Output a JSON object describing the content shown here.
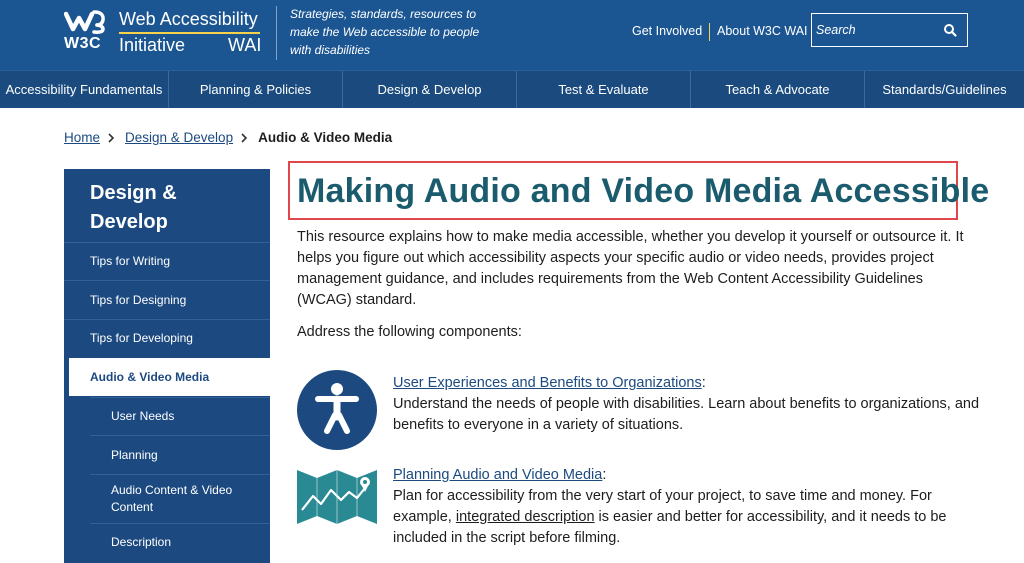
{
  "header": {
    "logo_w3c": "W3C",
    "logo_title_line1": "Web Accessibility",
    "logo_title_line2a": "Initiative",
    "logo_title_line2b": "WAI",
    "tagline": "Strategies, standards, resources to make the Web accessible to people with disabilities",
    "links": [
      "Get Involved",
      "About W3C WAI"
    ],
    "search_placeholder": "Search",
    "search_icon": "search-icon"
  },
  "nav": {
    "items": [
      "Accessibility Fundamentals",
      "Planning & Policies",
      "Design & Develop",
      "Test & Evaluate",
      "Teach & Advocate",
      "Standards/Guidelines"
    ]
  },
  "breadcrumb": {
    "items": [
      "Home",
      "Design & Develop"
    ],
    "current": "Audio & Video Media"
  },
  "sidebar": {
    "title": "Design & Develop",
    "items": [
      {
        "label": "Tips for Writing"
      },
      {
        "label": "Tips for Designing"
      },
      {
        "label": "Tips for Developing"
      },
      {
        "label": "Audio & Video Media"
      },
      {
        "label": "User Needs"
      },
      {
        "label": "Planning"
      },
      {
        "label": "Audio Content & Video Content"
      },
      {
        "label": "Description"
      }
    ]
  },
  "main": {
    "title": "Making Audio and Video Media Accessible",
    "intro": "This resource explains how to make media accessible, whether you develop it yourself or outsource it. It helps you figure out which accessibility aspects your specific audio or video needs, provides project management guidance, and includes requirements from the Web Content Accessibility Guidelines (WCAG) standard.",
    "address": "Address the following components:",
    "components": [
      {
        "icon": "accessibility-person-icon",
        "link": "User Experiences and Benefits to Organizations",
        "suffix": ":",
        "text": "Understand the needs of people with disabilities. Learn about benefits to organizations, and benefits to everyone in a variety of situations."
      },
      {
        "icon": "map-chart-icon",
        "link": "Planning Audio and Video Media",
        "suffix": ":",
        "text_before": "Plan for accessibility from the very start of your project, to save time and money. For example, ",
        "inline_link": "integrated description",
        "text_after": " is easier and better for accessibility, and it needs to be included in the script before filming."
      }
    ]
  },
  "colors": {
    "header_bg": "#1c5692",
    "nav_bg": "#1a4a7e",
    "sidebar_bg": "#1c4a80",
    "title_color": "#1b5b6e",
    "highlight_border": "#e0474c",
    "icon_teal": "#2a8a93",
    "accent_yellow": "#f6d24a"
  }
}
